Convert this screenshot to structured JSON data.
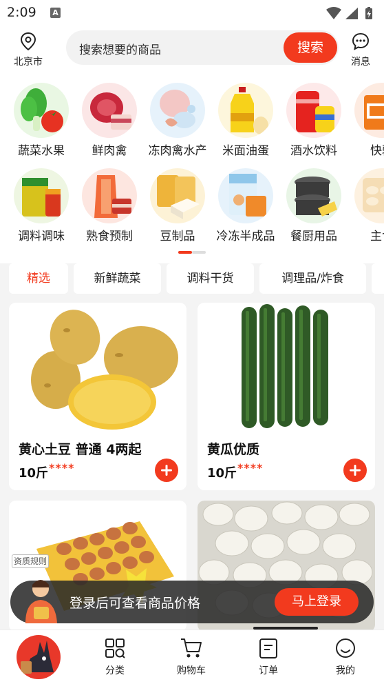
{
  "status_bar": {
    "time": "2:09",
    "notification_glyph": "A"
  },
  "header": {
    "location": "北京市",
    "search_placeholder": "搜索想要的商品",
    "search_button": "搜索",
    "messages_label": "消息"
  },
  "categories": {
    "row1": [
      {
        "label": "蔬菜水果",
        "icon": "vegetable-fruit-icon"
      },
      {
        "label": "鲜肉禽",
        "icon": "fresh-meat-icon"
      },
      {
        "label": "冻肉禽水产",
        "icon": "frozen-meat-icon"
      },
      {
        "label": "米面油蛋",
        "icon": "rice-oil-egg-icon"
      },
      {
        "label": "酒水饮料",
        "icon": "beverage-icon"
      },
      {
        "label": "快驴",
        "icon": "kuailv-icon"
      }
    ],
    "row2": [
      {
        "label": "调料调味",
        "icon": "seasoning-icon"
      },
      {
        "label": "熟食预制",
        "icon": "cooked-food-icon"
      },
      {
        "label": "豆制品",
        "icon": "tofu-icon"
      },
      {
        "label": "冷冻半成品",
        "icon": "frozen-semi-icon"
      },
      {
        "label": "餐厨用品",
        "icon": "kitchenware-icon"
      },
      {
        "label": "主食",
        "icon": "staple-food-icon"
      }
    ],
    "pager": {
      "pages": 2,
      "current": 1
    }
  },
  "tabs": [
    {
      "label": "精选",
      "active": true
    },
    {
      "label": "新鲜蔬菜",
      "active": false
    },
    {
      "label": "调料干货",
      "active": false
    },
    {
      "label": "调理品/炸食",
      "active": false
    }
  ],
  "products": [
    {
      "title": "黄心土豆 普通 4两起",
      "price": "10斤",
      "price_mask": "****",
      "image": "potato-image"
    },
    {
      "title": "黄瓜优质",
      "price": "10斤",
      "price_mask": "****",
      "image": "cucumber-image"
    },
    {
      "image": "egg-tray-image",
      "tag": "资质规则"
    },
    {
      "image": "garlic-image"
    }
  ],
  "login_banner": {
    "text": "登录后可查看商品价格",
    "button": "马上登录"
  },
  "bottom_nav": [
    {
      "label": "分类",
      "icon": "category-icon"
    },
    {
      "label": "购物车",
      "icon": "cart-icon"
    },
    {
      "label": "订单",
      "icon": "order-icon"
    },
    {
      "label": "我的",
      "icon": "profile-icon"
    }
  ],
  "colors": {
    "accent": "#f23a1e",
    "background": "#f4f4f4",
    "card": "#ffffff"
  }
}
